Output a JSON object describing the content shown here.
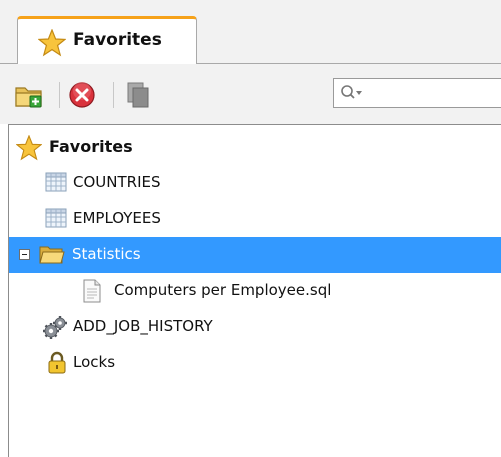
{
  "tab": {
    "label": "Favorites",
    "icon": "star-icon"
  },
  "toolbar": {
    "buttons": [
      {
        "name": "add-folder-button",
        "icon": "folder-add-icon"
      },
      {
        "name": "remove-button",
        "icon": "delete-icon"
      },
      {
        "name": "copy-button",
        "icon": "copy-icon"
      }
    ],
    "search": {
      "value": "",
      "placeholder": "",
      "icon": "search-dropdown-icon"
    }
  },
  "tree": {
    "items": [
      {
        "label": "Favorites",
        "icon": "star-icon",
        "level": 0,
        "bold": true
      },
      {
        "label": "COUNTRIES",
        "icon": "table-icon",
        "level": 1
      },
      {
        "label": "EMPLOYEES",
        "icon": "table-icon",
        "level": 1
      },
      {
        "label": "Statistics",
        "icon": "folder-open-icon",
        "level": 1,
        "expanded": true,
        "selected": true
      },
      {
        "label": "Computers per Employee.sql",
        "icon": "file-icon",
        "level": 2
      },
      {
        "label": "ADD_JOB_HISTORY",
        "icon": "gears-icon",
        "level": 1
      },
      {
        "label": "Locks",
        "icon": "lock-icon",
        "level": 1
      }
    ]
  },
  "colors": {
    "selection": "#3399ff",
    "tab_accent": "#f6a21a",
    "panel_bg": "#f2f2f2"
  }
}
